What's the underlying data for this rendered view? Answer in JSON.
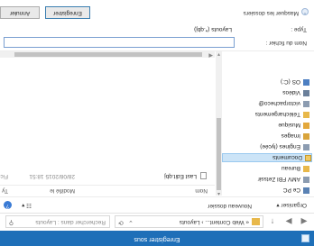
{
  "window": {
    "title": "Enregistrer sous"
  },
  "nav": {
    "back_glyph": "◀",
    "forward_glyph": "▶",
    "up_glyph": "↑",
    "address": "« Web Content... › Layouts",
    "address_caret": "⌄",
    "refresh_glyph": "⟳",
    "search_placeholder": "Rechercher dans : Layouts",
    "search_glyph": "⚲"
  },
  "commands": {
    "organize": "Organiser ▾",
    "new_folder": "Nouveau dossier",
    "view": "☷ ▾",
    "help": "?"
  },
  "tree": {
    "items": [
      {
        "label": "Ce PC",
        "icon": "pc-icon"
      },
      {
        "label": "AMV FBI Zetssir",
        "icon": "folder-icon"
      },
      {
        "label": "Bureau",
        "icon": "folder-icon"
      },
      {
        "label": "Documents",
        "icon": "folder-icon"
      },
      {
        "label": "Engines (lycée)",
        "icon": "user-icon"
      },
      {
        "label": "Images",
        "icon": "image-icon"
      },
      {
        "label": "Musique",
        "icon": "music-icon"
      },
      {
        "label": "Téléchargements",
        "icon": "folder-icon"
      },
      {
        "label": "victorpacheco@",
        "icon": "user-icon"
      },
      {
        "label": "Vidéos",
        "icon": "video-icon"
      },
      {
        "label": "OS (C:)",
        "icon": "network-icon"
      }
    ]
  },
  "list": {
    "columns": {
      "name": "Nom",
      "date": "Modifié le",
      "type": "Ty"
    },
    "rows": [
      {
        "name": "Last Edit.qbj",
        "date": "28/08/2015 18:51",
        "type": "Fic"
      }
    ]
  },
  "form": {
    "name_label": "Nom du fichier :",
    "name_value": "",
    "type_label": "Type :",
    "type_value": "Layouts (*.qbj)"
  },
  "footer": {
    "hide_folders": "Masquer les dossiers",
    "hide_chevron": "⌃",
    "save": "Enregistrer",
    "cancel": "Annuler"
  }
}
